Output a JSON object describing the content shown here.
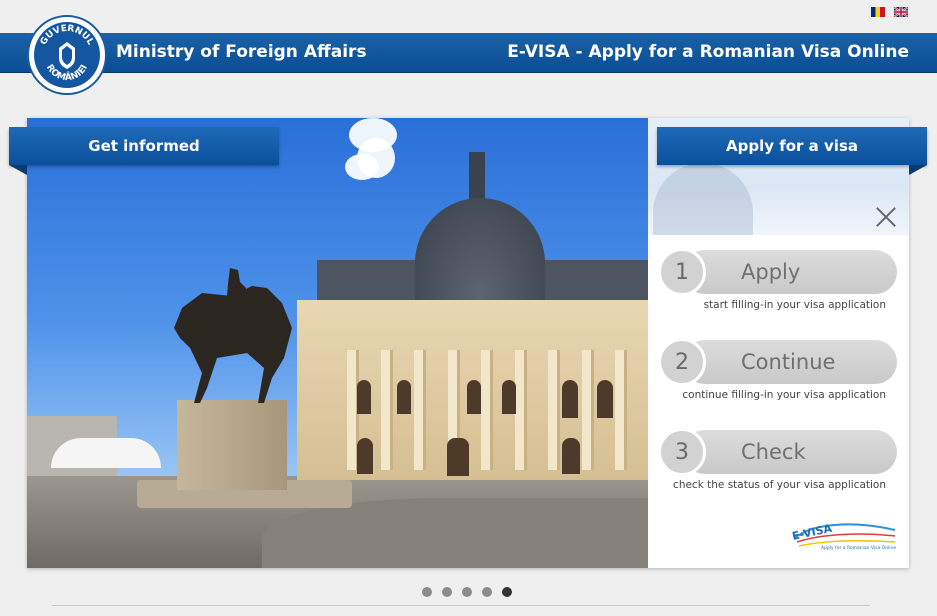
{
  "header": {
    "ministry": "Ministry of Foreign Affairs",
    "title": "E-VISA - Apply for a Romanian Visa Online",
    "seal_text_top": "GUVERNUL",
    "seal_text_bottom": "ROMÂNIEI"
  },
  "languages": [
    {
      "name": "romanian-flag-icon"
    },
    {
      "name": "uk-flag-icon"
    }
  ],
  "tabs": {
    "left": "Get informed",
    "right": "Apply for a visa"
  },
  "steps": [
    {
      "num": "1",
      "label": "Apply",
      "desc": "start filling-in your visa application"
    },
    {
      "num": "2",
      "label": "Continue",
      "desc": "continue filling-in your visa application"
    },
    {
      "num": "3",
      "label": "Check",
      "desc": "check the status of your visa application"
    }
  ],
  "logo": {
    "text": "E-VISA",
    "tagline": "Apply for a Romanian Visa Online"
  },
  "carousel": {
    "count": 5,
    "active_index": 4
  },
  "colors": {
    "header_blue": "#0a4d95",
    "tab_blue": "#1f6ab8",
    "pill_gray": "#d2d2d2"
  }
}
